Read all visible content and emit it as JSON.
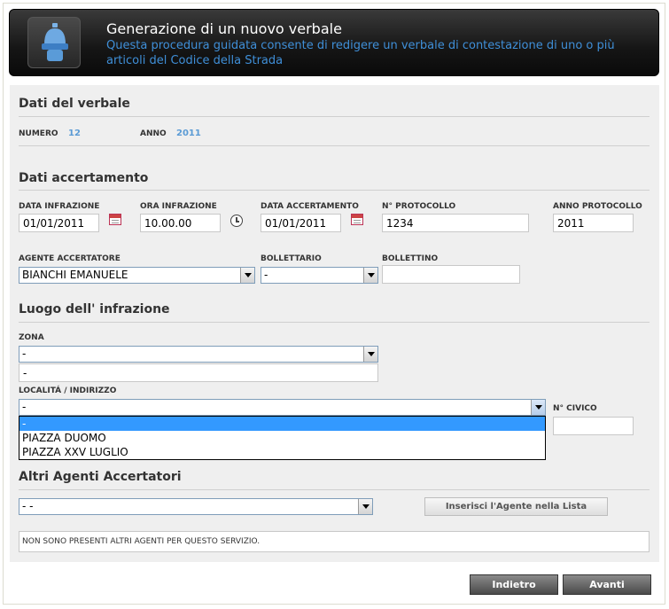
{
  "header": {
    "title": "Generazione di un nuovo verbale",
    "subtitle": "Questa procedura guidata consente di redigere un verbale di contestazione di uno o più articoli del Codice della Strada",
    "icon": "police-helmet-icon"
  },
  "dati_verbale": {
    "title": "Dati del verbale",
    "numero_label": "NUMERO",
    "numero_value": "12",
    "anno_label": "ANNO",
    "anno_value": "2011"
  },
  "dati_accertamento": {
    "title": "Dati accertamento",
    "data_infrazione_label": "DATA INFRAZIONE",
    "data_infrazione_value": "01/01/2011",
    "ora_infrazione_label": "ORA INFRAZIONE",
    "ora_infrazione_value": "10.00.00",
    "data_accertamento_label": "DATA ACCERTAMENTO",
    "data_accertamento_value": "01/01/2011",
    "protocollo_label": "N° PROTOCOLLO",
    "protocollo_value": "1234",
    "anno_protocollo_label": "ANNO PROTOCOLLO",
    "anno_protocollo_value": "2011",
    "agente_label": "AGENTE ACCERTATORE",
    "agente_value": "BIANCHI EMANUELE",
    "bollettario_label": "BOLLETTARIO",
    "bollettario_value": "-",
    "bollettino_label": "BOLLETTINO",
    "bollettino_value": ""
  },
  "luogo": {
    "title": "Luogo dell' infrazione",
    "zona_label": "ZONA",
    "zona_value": "-",
    "zona_text_value": "-",
    "localita_label": "LOCALITÁ / INDIRIZZO",
    "localita_value": "-",
    "localita_options": [
      "-",
      "PIAZZA DUOMO",
      "PIAZZA XXV LUGLIO"
    ],
    "civico_label": "N° CIVICO",
    "civico_value": ""
  },
  "altri_agenti": {
    "title": "Altri Agenti Accertatori",
    "select_value": "- -",
    "insert_button": "Inserisci l'Agente nella Lista",
    "empty_message": "NON SONO PRESENTI ALTRI AGENTI PER QUESTO SERVIZIO."
  },
  "footer": {
    "back_button": "Indietro",
    "next_button": "Avanti"
  },
  "colors": {
    "accent_blue": "#3f8fd8",
    "selected_option": "#3399ff"
  }
}
